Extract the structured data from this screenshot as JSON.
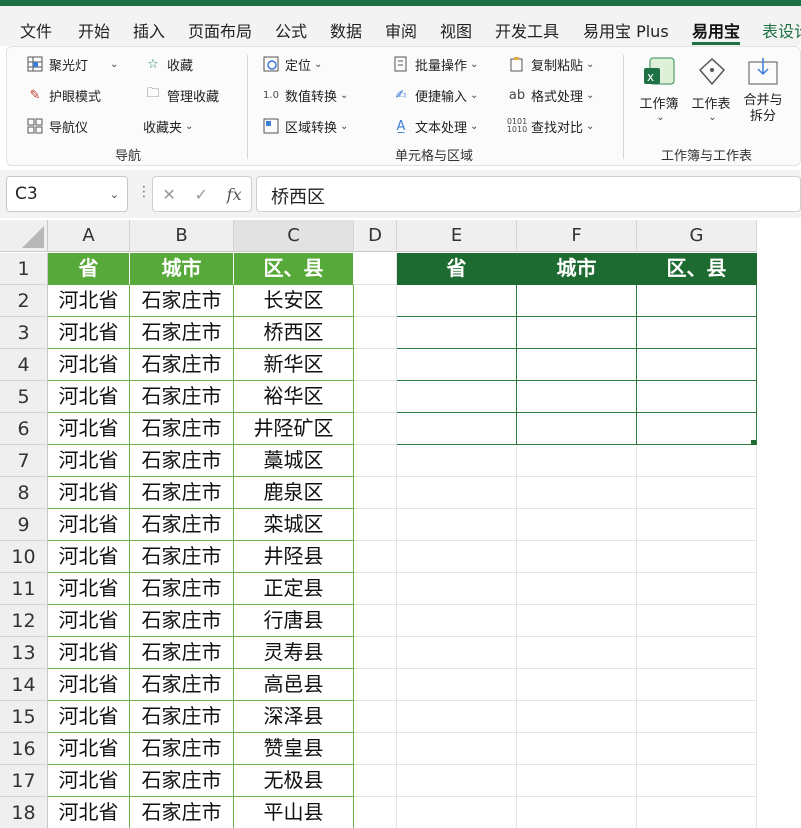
{
  "menu_tabs": [
    "文件",
    "开始",
    "插入",
    "页面布局",
    "公式",
    "数据",
    "审阅",
    "视图",
    "开发工具",
    "易用宝 Plus",
    "易用宝",
    "表设计"
  ],
  "ribbon": {
    "nav_group": {
      "label": "导航",
      "buttons": [
        "聚光灯",
        "收藏",
        "护眼模式",
        "管理收藏",
        "导航仪",
        "收藏夹"
      ]
    },
    "cell_group": {
      "label": "单元格与区域",
      "buttons": [
        "定位",
        "批量操作",
        "复制粘贴",
        "数值转换",
        "便捷输入",
        "格式处理",
        "区域转换",
        "文本处理",
        "查找对比"
      ]
    },
    "book_group": {
      "label": "工作簿与工作表",
      "buttons": [
        "工作簿",
        "工作表",
        "合并与\n拆分"
      ]
    }
  },
  "formula_bar": {
    "name_box": "C3",
    "fx": "fx",
    "content": "桥西区"
  },
  "columns": [
    "A",
    "B",
    "C",
    "D",
    "E",
    "F",
    "G"
  ],
  "selected_column": "C",
  "rows": [
    "1",
    "2",
    "3",
    "4",
    "5",
    "6",
    "7",
    "8",
    "9",
    "10",
    "11",
    "12",
    "13",
    "14",
    "15",
    "16",
    "17",
    "18"
  ],
  "table1": {
    "headers": [
      "省",
      "城市",
      "区、县"
    ],
    "rows": [
      [
        "河北省",
        "石家庄市",
        "长安区"
      ],
      [
        "河北省",
        "石家庄市",
        "桥西区"
      ],
      [
        "河北省",
        "石家庄市",
        "新华区"
      ],
      [
        "河北省",
        "石家庄市",
        "裕华区"
      ],
      [
        "河北省",
        "石家庄市",
        "井陉矿区"
      ],
      [
        "河北省",
        "石家庄市",
        "藁城区"
      ],
      [
        "河北省",
        "石家庄市",
        "鹿泉区"
      ],
      [
        "河北省",
        "石家庄市",
        "栾城区"
      ],
      [
        "河北省",
        "石家庄市",
        "井陉县"
      ],
      [
        "河北省",
        "石家庄市",
        "正定县"
      ],
      [
        "河北省",
        "石家庄市",
        "行唐县"
      ],
      [
        "河北省",
        "石家庄市",
        "灵寿县"
      ],
      [
        "河北省",
        "石家庄市",
        "高邑县"
      ],
      [
        "河北省",
        "石家庄市",
        "深泽县"
      ],
      [
        "河北省",
        "石家庄市",
        "赞皇县"
      ],
      [
        "河北省",
        "石家庄市",
        "无极县"
      ],
      [
        "河北省",
        "石家庄市",
        "平山县"
      ]
    ]
  },
  "table2": {
    "headers": [
      "省",
      "城市",
      "区、县"
    ],
    "empty_rows": 5
  },
  "colors": {
    "accent": "#1e7145",
    "table1_header": "#57a93a",
    "table2_header": "#1e6b31"
  }
}
